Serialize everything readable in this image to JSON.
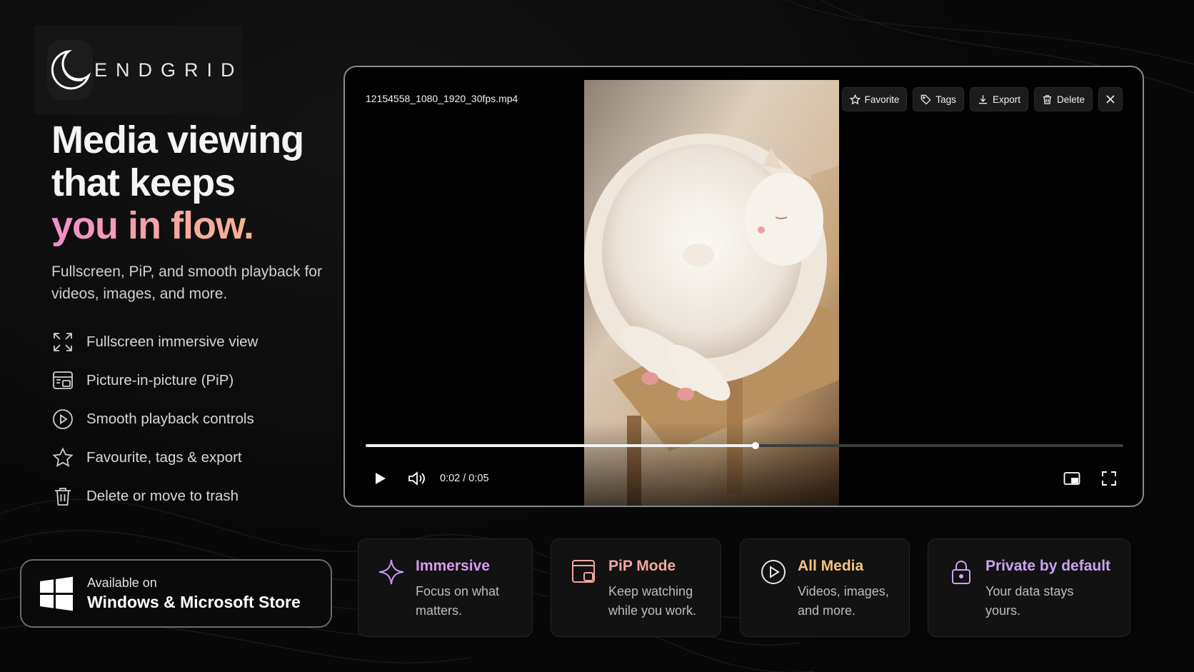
{
  "brand": {
    "name": "ENDGRID"
  },
  "hero": {
    "line1": "Media viewing",
    "line2": "that keeps",
    "line3": "you in flow.",
    "subtitle": "Fullscreen, PiP, and smooth playback for videos, images, and more."
  },
  "features": [
    {
      "icon": "fullscreen-icon",
      "label": "Fullscreen immersive view"
    },
    {
      "icon": "pip-icon",
      "label": "Picture-in-picture (PiP)"
    },
    {
      "icon": "play-circle-icon",
      "label": "Smooth playback controls"
    },
    {
      "icon": "star-icon",
      "label": "Favourite, tags & export"
    },
    {
      "icon": "trash-icon",
      "label": "Delete or move to trash"
    }
  ],
  "store": {
    "small": "Available on",
    "big": "Windows & Microsoft Store"
  },
  "player": {
    "filename": "12154558_1080_1920_30fps.mp4",
    "toolbar": {
      "favorite": "Favorite",
      "tags": "Tags",
      "export": "Export",
      "delete": "Delete"
    },
    "time": "0:02 / 0:05",
    "progress": 0.515
  },
  "cards": [
    {
      "icon": "sparkle-icon",
      "title": "Immersive",
      "desc1": "Focus on what",
      "desc2": "matters.",
      "color": "#d89bf0"
    },
    {
      "icon": "pip-window-icon",
      "title": "PiP Mode",
      "desc1": "Keep watching",
      "desc2": "while you work.",
      "color": "#f4a6a0"
    },
    {
      "icon": "play-circle-icon",
      "title": "All Media",
      "desc1": "Videos, images,",
      "desc2": "and more.",
      "color": "#f6c27e"
    },
    {
      "icon": "lock-icon",
      "title": "Private by default",
      "desc1": "Your data stays",
      "desc2": "yours.",
      "color": "#c9a4f2"
    }
  ]
}
